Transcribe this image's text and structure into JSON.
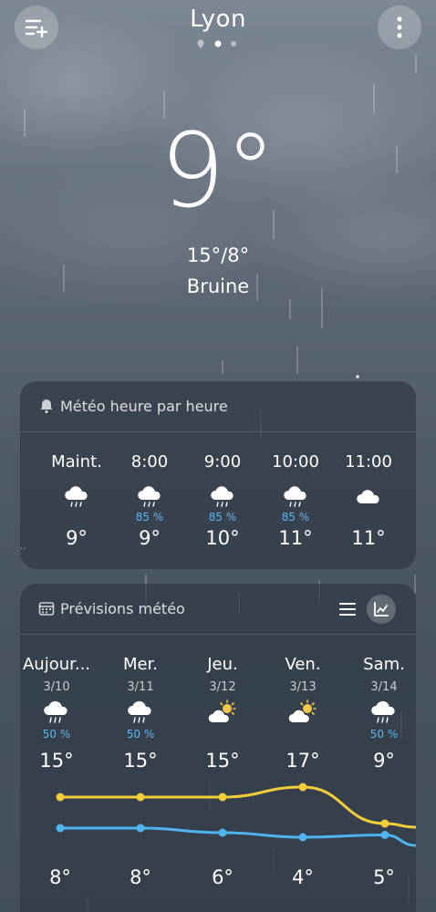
{
  "header": {
    "city": "Lyon",
    "menu_icon": "add-list-icon",
    "more_icon": "more-vertical-icon",
    "page_indicator": {
      "count": 3,
      "active": 1,
      "first_is_location": true
    }
  },
  "current": {
    "temperature": "9°",
    "high_low": "15°/8°",
    "condition": "Bruine"
  },
  "hourly": {
    "title": "Météo heure par heure",
    "icon": "bell-icon",
    "hours": [
      {
        "time": "Maint.",
        "icon": "rain-cloud-icon",
        "precip": "",
        "temp": "9°"
      },
      {
        "time": "8:00",
        "icon": "rain-cloud-icon",
        "precip": "85 %",
        "temp": "9°"
      },
      {
        "time": "9:00",
        "icon": "rain-cloud-icon",
        "precip": "85 %",
        "temp": "10°"
      },
      {
        "time": "10:00",
        "icon": "rain-cloud-icon",
        "precip": "85 %",
        "temp": "11°"
      },
      {
        "time": "11:00",
        "icon": "cloud-icon",
        "precip": "",
        "temp": "11°"
      }
    ]
  },
  "forecast": {
    "title": "Prévisions météo",
    "icon": "calendar-icon",
    "list_view_icon": "list-icon",
    "chart_view_icon": "line-chart-icon",
    "days": [
      {
        "name": "Aujour...",
        "date": "3/10",
        "icon": "rain-cloud-icon",
        "precip": "50 %",
        "high": "15°",
        "low": "8°"
      },
      {
        "name": "Mer.",
        "date": "3/11",
        "icon": "rain-cloud-icon",
        "precip": "50 %",
        "high": "15°",
        "low": "8°"
      },
      {
        "name": "Jeu.",
        "date": "3/12",
        "icon": "partly-sunny-icon",
        "precip": "",
        "high": "15°",
        "low": "6°"
      },
      {
        "name": "Ven.",
        "date": "3/13",
        "icon": "partly-sunny-icon",
        "precip": "",
        "high": "17°",
        "low": "4°"
      },
      {
        "name": "Sam.",
        "date": "3/14",
        "icon": "rain-cloud-icon",
        "precip": "50 %",
        "high": "9°",
        "low": "5°"
      }
    ]
  },
  "colors": {
    "high_line": "#f3cd3a",
    "low_line": "#4fb4ee",
    "precip_text": "#5fb6ec"
  }
}
